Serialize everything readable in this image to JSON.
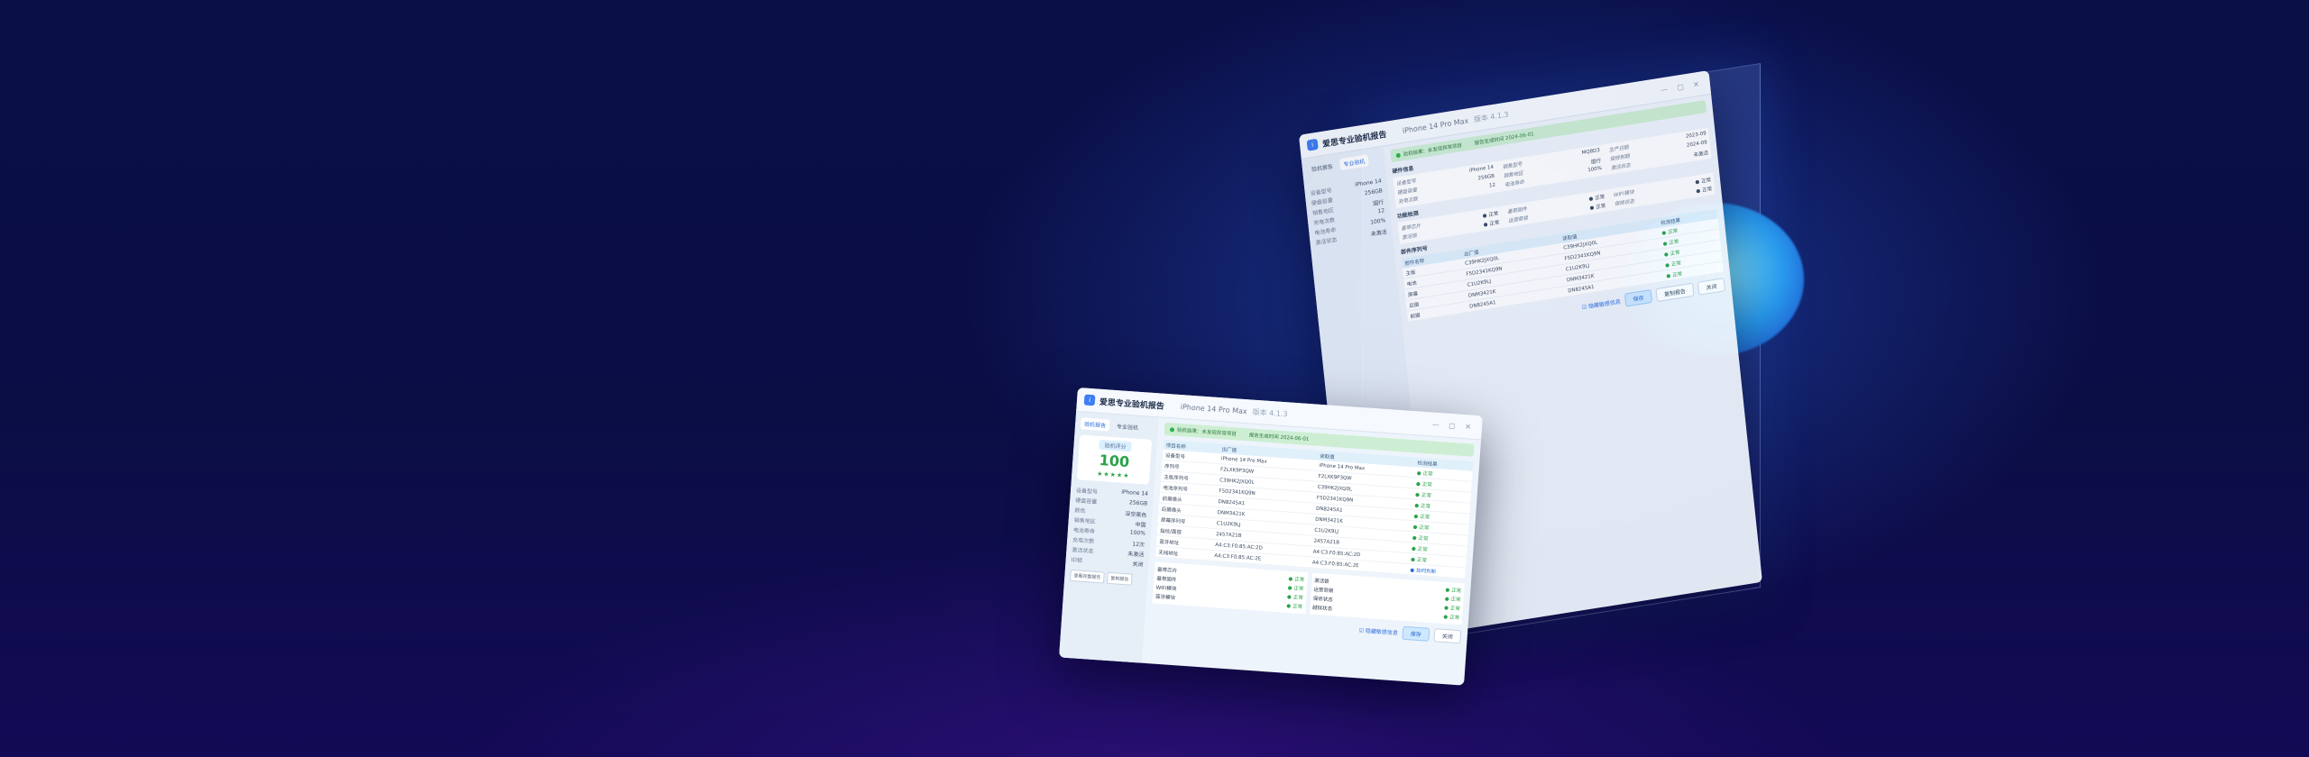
{
  "app": {
    "title": "爱思专业验机报告",
    "model": "iPhone 14 Pro Max",
    "version": "版本 4.1.3",
    "window_controls": "— ▢ ✕"
  },
  "front": {
    "tabs": [
      "验机报告",
      "专业验机"
    ],
    "score_label": "验机评分",
    "score": "100",
    "stars": "★★★★★",
    "side_rows": [
      {
        "k": "设备型号",
        "v": "iPhone 14"
      },
      {
        "k": "硬盘容量",
        "v": "256GB"
      },
      {
        "k": "颜色",
        "v": "深空黑色"
      },
      {
        "k": "销售地区",
        "v": "中国"
      },
      {
        "k": "电池寿命",
        "v": "100%"
      },
      {
        "k": "充电次数",
        "v": "12次"
      },
      {
        "k": "激活状态",
        "v": "未激活"
      },
      {
        "k": "ID锁",
        "v": "关闭"
      }
    ],
    "side_buttons": [
      "查看完整报告",
      "复制报告"
    ],
    "banner": [
      "验机结果：未发现异常项目",
      "报告生成时间 2024-06-01"
    ],
    "table_headers": [
      "项目名称",
      "出厂值",
      "读取值",
      "检测结果"
    ],
    "rows": [
      {
        "name": "设备型号",
        "factory": "iPhone 14 Pro Max",
        "read": "iPhone 14 Pro Max",
        "result": "正常",
        "kind": "ok"
      },
      {
        "name": "序列号",
        "factory": "F2LXK9P3QW",
        "read": "F2LXK9P3QW",
        "result": "正常",
        "kind": "ok"
      },
      {
        "name": "主板序列号",
        "factory": "C39HK2JXQ0L",
        "read": "C39HK2JXQ0L",
        "result": "正常",
        "kind": "ok"
      },
      {
        "name": "电池序列号",
        "factory": "F5D2341KQ9N",
        "read": "F5D2341KQ9N",
        "result": "正常",
        "kind": "ok"
      },
      {
        "name": "前摄像头",
        "factory": "DN8245A1",
        "read": "DN8245A1",
        "result": "正常",
        "kind": "ok"
      },
      {
        "name": "后摄像头",
        "factory": "DNM3421K",
        "read": "DNM3421K",
        "result": "正常",
        "kind": "ok"
      },
      {
        "name": "屏幕序列号",
        "factory": "C1U2K9LJ",
        "read": "C1U2K9LJ",
        "result": "正常",
        "kind": "ok"
      },
      {
        "name": "指纹/面容",
        "factory": "2457A21B",
        "read": "2457A21B",
        "result": "正常",
        "kind": "ok"
      },
      {
        "name": "蓝牙地址",
        "factory": "A4:C3:F0:85:AC:2D",
        "read": "A4:C3:F0:85:AC:2D",
        "result": "正常",
        "kind": "ok"
      },
      {
        "name": "无线地址",
        "factory": "A4:C3:F0:85:AC:2E",
        "read": "A4:C3:F0:85:AC:2E",
        "result": "如何判断",
        "kind": "info"
      }
    ],
    "mini_left": [
      {
        "k": "基带芯片",
        "v": "正常"
      },
      {
        "k": "基带固件",
        "v": "正常"
      },
      {
        "k": "WIFI模块",
        "v": "正常"
      },
      {
        "k": "蓝牙模块",
        "v": "正常"
      }
    ],
    "mini_right": [
      {
        "k": "激活锁",
        "v": "正常"
      },
      {
        "k": "运营商锁",
        "v": "正常"
      },
      {
        "k": "保修状态",
        "v": "正常"
      },
      {
        "k": "越狱状态",
        "v": "正常"
      }
    ],
    "footer_check": "☑ 隐藏敏感信息",
    "footer_buttons": [
      "保存",
      "关闭"
    ]
  },
  "back": {
    "tabs": [
      "验机报告",
      "专业验机"
    ],
    "banner": [
      "验机结果：未发现异常项目",
      "报告生成时间 2024-06-01"
    ],
    "sec1": "硬件信息",
    "kv": [
      {
        "k": "设备型号",
        "v": "iPhone 14"
      },
      {
        "k": "销售型号",
        "v": "MQ8D3"
      },
      {
        "k": "生产日期",
        "v": "2023-09"
      },
      {
        "k": "硬盘容量",
        "v": "256GB"
      },
      {
        "k": "销售地区",
        "v": "国行"
      },
      {
        "k": "保修到期",
        "v": "2024-09"
      },
      {
        "k": "充电次数",
        "v": "12"
      },
      {
        "k": "电池寿命",
        "v": "100%"
      },
      {
        "k": "激活状态",
        "v": "未激活"
      }
    ],
    "sec2": "功能检测",
    "sec3": "部件序列号",
    "table_headers": [
      "部件名称",
      "出厂值",
      "读取值",
      "检测结果"
    ],
    "rows": [
      {
        "name": "主板",
        "factory": "C39HK2JXQ0L",
        "read": "C39HK2JXQ0L",
        "result": "正常"
      },
      {
        "name": "电池",
        "factory": "F5D2341KQ9N",
        "read": "F5D2341KQ9N",
        "result": "正常"
      },
      {
        "name": "屏幕",
        "factory": "C1U2K9LJ",
        "read": "C1U2K9LJ",
        "result": "正常"
      },
      {
        "name": "后摄",
        "factory": "DNM3421K",
        "read": "DNM3421K",
        "result": "正常"
      },
      {
        "name": "前摄",
        "factory": "DN8245A1",
        "read": "DN8245A1",
        "result": "正常"
      }
    ],
    "footer_check": "☑ 隐藏敏感信息",
    "footer_buttons": [
      "保存",
      "复制报告",
      "关闭"
    ]
  }
}
